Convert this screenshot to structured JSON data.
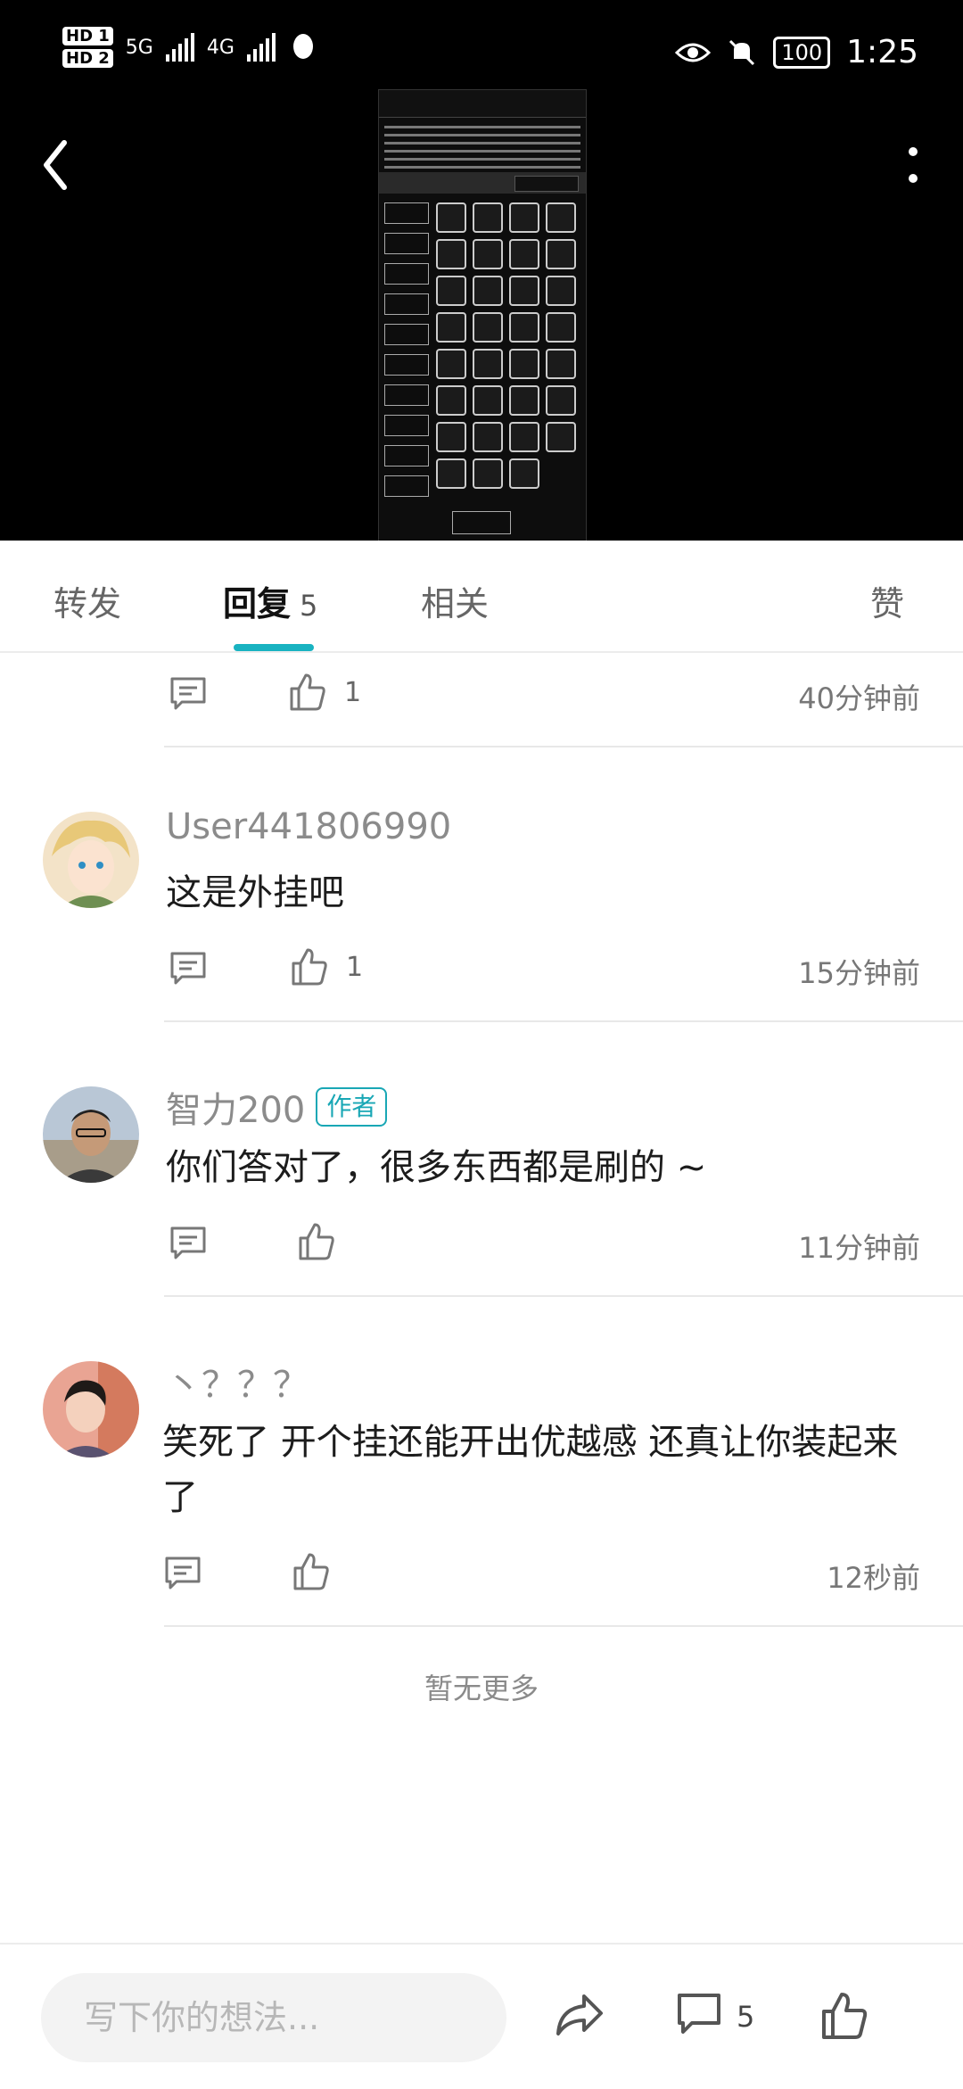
{
  "status_bar": {
    "hd1": "HD 1",
    "hd2": "HD 2",
    "net1": "5G",
    "net2": "4G",
    "battery": "100",
    "time": "1:25"
  },
  "tabs": [
    {
      "label": "转发"
    },
    {
      "label": "回复",
      "count": "5"
    },
    {
      "label": "相关"
    },
    {
      "label": "赞"
    }
  ],
  "comments": [
    {
      "likes": "1",
      "time": "40分钟前"
    },
    {
      "user": "User441806990",
      "text": "这是外挂吧",
      "likes": "1",
      "time": "15分钟前"
    },
    {
      "user": "智力200",
      "badge": "作者",
      "text": "你们答对了，很多东西都是刷的 ~",
      "likes": "",
      "time": "11分钟前"
    },
    {
      "user": "丶？？？",
      "text": "笑死了 开个挂还能开出优越感 还真让你装起来了",
      "likes": "",
      "time": "12秒前"
    }
  ],
  "no_more": "暂无更多",
  "bottom_bar": {
    "placeholder": "写下你的想法...",
    "comment_count": "5"
  },
  "colors": {
    "accent": "#19b3c1",
    "media_bg": "#000000"
  },
  "icons": [
    "back-icon",
    "more-icon",
    "comment-icon",
    "like-icon",
    "share-icon",
    "eye-icon",
    "mute-icon"
  ]
}
